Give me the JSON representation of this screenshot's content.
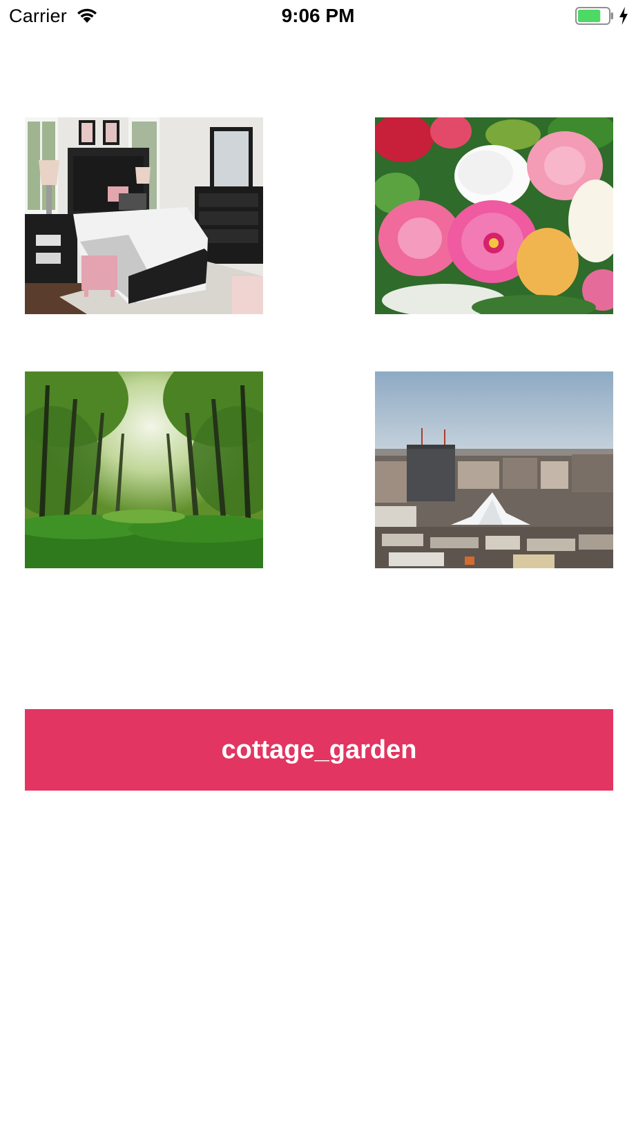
{
  "status_bar": {
    "carrier": "Carrier",
    "time": "9:06 PM",
    "wifi_icon": "wifi-icon",
    "battery_icon": "battery-charging-icon",
    "battery_fill_fraction": 0.75,
    "battery_color": "#4cd964"
  },
  "gallery": {
    "images": [
      {
        "name": "bedroom-image",
        "subject": "bedroom"
      },
      {
        "name": "flowers-image",
        "subject": "flowers"
      },
      {
        "name": "forest-image",
        "subject": "forest"
      },
      {
        "name": "city-image",
        "subject": "city"
      }
    ]
  },
  "action_button": {
    "label": "cottage_garden",
    "background_color": "#e23561",
    "text_color": "#ffffff"
  }
}
